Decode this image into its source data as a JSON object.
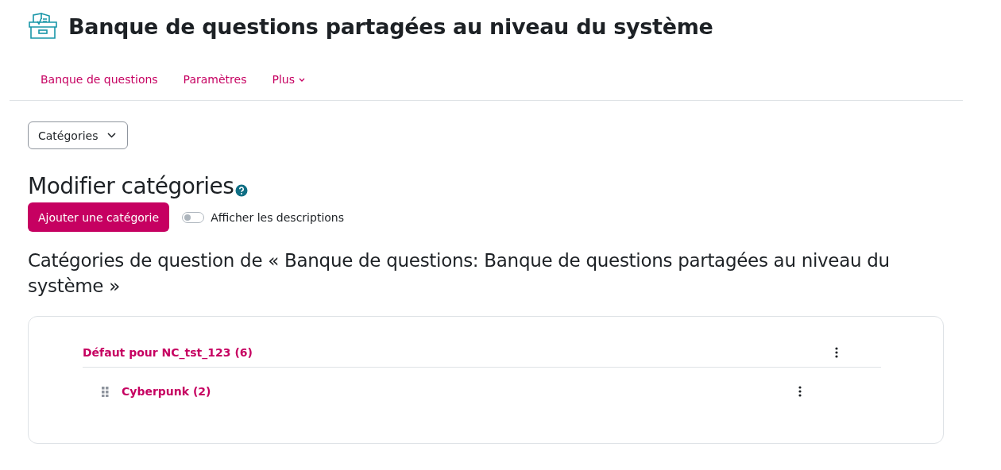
{
  "page_title": "Banque de questions partagées au niveau du système",
  "nav": [
    {
      "label": "Banque de questions",
      "kind": "link"
    },
    {
      "label": "Paramètres",
      "kind": "link"
    },
    {
      "label": "Plus",
      "kind": "dropdown"
    }
  ],
  "select": {
    "value": "Catégories"
  },
  "heading": "Modifier catégories",
  "add_button": "Ajouter une catégorie",
  "toggle": {
    "label": "Afficher les descriptions",
    "on": false
  },
  "subheading": "Catégories de question de « Banque de questions: Banque de questions partagées au niveau du système »",
  "categories": [
    {
      "name": "Défaut pour NC_tst_123 (6)",
      "children": [
        {
          "name": "Cyberpunk (2)"
        }
      ]
    }
  ]
}
